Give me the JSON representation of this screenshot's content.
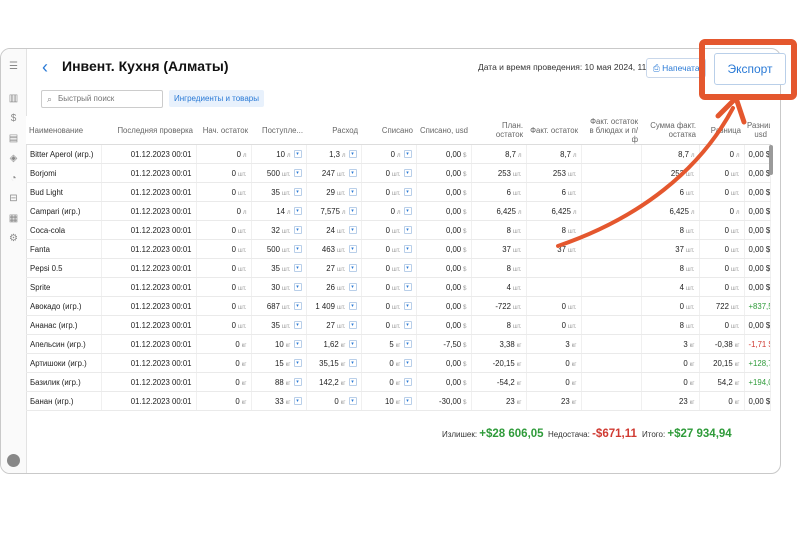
{
  "header": {
    "title": "Инвент. Кухня (Алматы)",
    "datetime": "Дата и время проведения: 10 мая 2024, 11:05",
    "print_label": "Напечатать",
    "export_label": "Экспорт"
  },
  "search": {
    "placeholder": "Быстрый поиск"
  },
  "filter_label": "Ингредиенты и товары",
  "columns": [
    "Наименование",
    "Последняя проверка",
    "Нач. остаток",
    "Поступле...",
    "Расход",
    "Списано",
    "Списано, usd",
    "План. остаток",
    "Факт. остаток",
    "Факт. остаток в блюдах и п/ф",
    "Сумма факт. остатка",
    "Разница",
    "Разница, usd"
  ],
  "rows": [
    {
      "name": "Bitter Aperol (игр.)",
      "date": "01.12.2023 00:01",
      "start": "0",
      "start_u": "л",
      "in": "10",
      "in_u": "л",
      "out": "1,3",
      "out_u": "л",
      "wo": "0",
      "wo_u": "л",
      "wo_usd": "0,00",
      "plan": "8,7",
      "plan_u": "л",
      "fact": "8,7",
      "fact_u": "л",
      "dish": "",
      "sum": "8,7",
      "sum_u": "л",
      "diff": "0",
      "diff_u": "л",
      "diff_usd": "0,00 $",
      "cls": ""
    },
    {
      "name": "Borjomi",
      "date": "01.12.2023 00:01",
      "start": "0",
      "start_u": "шт.",
      "in": "500",
      "in_u": "шт.",
      "out": "247",
      "out_u": "шт.",
      "wo": "0",
      "wo_u": "шт.",
      "wo_usd": "0,00",
      "plan": "253",
      "plan_u": "шт.",
      "fact": "253",
      "fact_u": "шт.",
      "dish": "",
      "sum": "253",
      "sum_u": "шт.",
      "diff": "0",
      "diff_u": "шт.",
      "diff_usd": "0,00 $",
      "cls": ""
    },
    {
      "name": "Bud Light",
      "date": "01.12.2023 00:01",
      "start": "0",
      "start_u": "шт.",
      "in": "35",
      "in_u": "шт.",
      "out": "29",
      "out_u": "шт.",
      "wo": "0",
      "wo_u": "шт.",
      "wo_usd": "0,00",
      "plan": "6",
      "plan_u": "шт.",
      "fact": "6",
      "fact_u": "шт.",
      "dish": "",
      "sum": "6",
      "sum_u": "шт.",
      "diff": "0",
      "diff_u": "шт.",
      "diff_usd": "0,00 $",
      "cls": ""
    },
    {
      "name": "Campari (игр.)",
      "date": "01.12.2023 00:01",
      "start": "0",
      "start_u": "л",
      "in": "14",
      "in_u": "л",
      "out": "7,575",
      "out_u": "л",
      "wo": "0",
      "wo_u": "л",
      "wo_usd": "0,00",
      "plan": "6,425",
      "plan_u": "л",
      "fact": "6,425",
      "fact_u": "л",
      "dish": "",
      "sum": "6,425",
      "sum_u": "л",
      "diff": "0",
      "diff_u": "л",
      "diff_usd": "0,00 $",
      "cls": ""
    },
    {
      "name": "Coca-cola",
      "date": "01.12.2023 00:01",
      "start": "0",
      "start_u": "шт.",
      "in": "32",
      "in_u": "шт.",
      "out": "24",
      "out_u": "шт.",
      "wo": "0",
      "wo_u": "шт.",
      "wo_usd": "0,00",
      "plan": "8",
      "plan_u": "шт.",
      "fact": "8",
      "fact_u": "шт.",
      "dish": "",
      "sum": "8",
      "sum_u": "шт.",
      "diff": "0",
      "diff_u": "шт.",
      "diff_usd": "0,00 $",
      "cls": ""
    },
    {
      "name": "Fanta",
      "date": "01.12.2023 00:01",
      "start": "0",
      "start_u": "шт.",
      "in": "500",
      "in_u": "шт.",
      "out": "463",
      "out_u": "шт.",
      "wo": "0",
      "wo_u": "шт.",
      "wo_usd": "0,00",
      "plan": "37",
      "plan_u": "шт.",
      "fact": "37",
      "fact_u": "шт.",
      "dish": "",
      "sum": "37",
      "sum_u": "шт.",
      "diff": "0",
      "diff_u": "шт.",
      "diff_usd": "0,00 $",
      "cls": ""
    },
    {
      "name": "Pepsi 0.5",
      "date": "01.12.2023 00:01",
      "start": "0",
      "start_u": "шт.",
      "in": "35",
      "in_u": "шт.",
      "out": "27",
      "out_u": "шт.",
      "wo": "0",
      "wo_u": "шт.",
      "wo_usd": "0,00",
      "plan": "8",
      "plan_u": "шт.",
      "fact": "",
      "fact_u": "",
      "dish": "",
      "sum": "8",
      "sum_u": "шт.",
      "diff": "0",
      "diff_u": "шт.",
      "diff_usd": "0,00 $",
      "cls": ""
    },
    {
      "name": "Sprite",
      "date": "01.12.2023 00:01",
      "start": "0",
      "start_u": "шт.",
      "in": "30",
      "in_u": "шт.",
      "out": "26",
      "out_u": "шт.",
      "wo": "0",
      "wo_u": "шт.",
      "wo_usd": "0,00",
      "plan": "4",
      "plan_u": "шт.",
      "fact": "",
      "fact_u": "",
      "dish": "",
      "sum": "4",
      "sum_u": "шт.",
      "diff": "0",
      "diff_u": "шт.",
      "diff_usd": "0,00 $",
      "cls": ""
    },
    {
      "name": "Авокадо (игр.)",
      "date": "01.12.2023 00:01",
      "start": "0",
      "start_u": "шт.",
      "in": "687",
      "in_u": "шт.",
      "out": "1 409",
      "out_u": "шт.",
      "wo": "0",
      "wo_u": "шт.",
      "wo_usd": "0,00",
      "plan": "-722",
      "plan_u": "шт.",
      "fact": "0",
      "fact_u": "шт.",
      "dish": "",
      "sum": "0",
      "sum_u": "шт.",
      "diff": "722",
      "diff_u": "шт.",
      "diff_usd": "+837,52 $",
      "cls": "pos"
    },
    {
      "name": "Ананас (игр.)",
      "date": "01.12.2023 00:01",
      "start": "0",
      "start_u": "шт.",
      "in": "35",
      "in_u": "шт.",
      "out": "27",
      "out_u": "шт.",
      "wo": "0",
      "wo_u": "шт.",
      "wo_usd": "0,00",
      "plan": "8",
      "plan_u": "шт.",
      "fact": "0",
      "fact_u": "шт.",
      "dish": "",
      "sum": "8",
      "sum_u": "шт.",
      "diff": "0",
      "diff_u": "шт.",
      "diff_usd": "0,00 $",
      "cls": ""
    },
    {
      "name": "Апельсин (игр.)",
      "date": "01.12.2023 00:01",
      "start": "0",
      "start_u": "кг",
      "in": "10",
      "in_u": "кг",
      "out": "1,62",
      "out_u": "кг",
      "wo": "5",
      "wo_u": "кг",
      "wo_usd": "-7,50",
      "plan": "3,38",
      "plan_u": "кг",
      "fact": "3",
      "fact_u": "кг",
      "dish": "",
      "sum": "3",
      "sum_u": "кг",
      "diff": "-0,38",
      "diff_u": "кг",
      "diff_usd": "-1,71 $",
      "cls": "neg"
    },
    {
      "name": "Артишоки (игр.)",
      "date": "01.12.2023 00:01",
      "start": "0",
      "start_u": "кг",
      "in": "15",
      "in_u": "кг",
      "out": "35,15",
      "out_u": "кг",
      "wo": "0",
      "wo_u": "кг",
      "wo_usd": "0,00",
      "plan": "-20,15",
      "plan_u": "кг",
      "fact": "0",
      "fact_u": "кг",
      "dish": "",
      "sum": "0",
      "sum_u": "кг",
      "diff": "20,15",
      "diff_u": "кг",
      "diff_usd": "+128,76 $",
      "cls": "pos"
    },
    {
      "name": "Базилик (игр.)",
      "date": "01.12.2023 00:01",
      "start": "0",
      "start_u": "кг",
      "in": "88",
      "in_u": "кг",
      "out": "142,2",
      "out_u": "кг",
      "wo": "0",
      "wo_u": "кг",
      "wo_usd": "0,00",
      "plan": "-54,2",
      "plan_u": "кг",
      "fact": "0",
      "fact_u": "кг",
      "dish": "",
      "sum": "0",
      "sum_u": "кг",
      "diff": "54,2",
      "diff_u": "кг",
      "diff_usd": "+194,04 $",
      "cls": "pos"
    },
    {
      "name": "Банан (игр.)",
      "date": "01.12.2023 00:01",
      "start": "0",
      "start_u": "кг",
      "in": "33",
      "in_u": "кг",
      "out": "0",
      "out_u": "кг",
      "wo": "10",
      "wo_u": "кг",
      "wo_usd": "-30,00",
      "plan": "23",
      "plan_u": "кг",
      "fact": "23",
      "fact_u": "кг",
      "dish": "",
      "sum": "23",
      "sum_u": "кг",
      "diff": "0",
      "diff_u": "кг",
      "diff_usd": "0,00 $",
      "cls": ""
    }
  ],
  "summary": {
    "surplus_label": "Излишек:",
    "surplus": "+$28 606,05",
    "shortage_label": "Недостача:",
    "shortage": "-$671,11",
    "total_label": "Итого:",
    "total": "+$27 934,94"
  },
  "colors": {
    "accent": "#2a7ad6",
    "highlight": "#e4572e",
    "positive": "#2f9b3a",
    "negative": "#d03a32"
  }
}
